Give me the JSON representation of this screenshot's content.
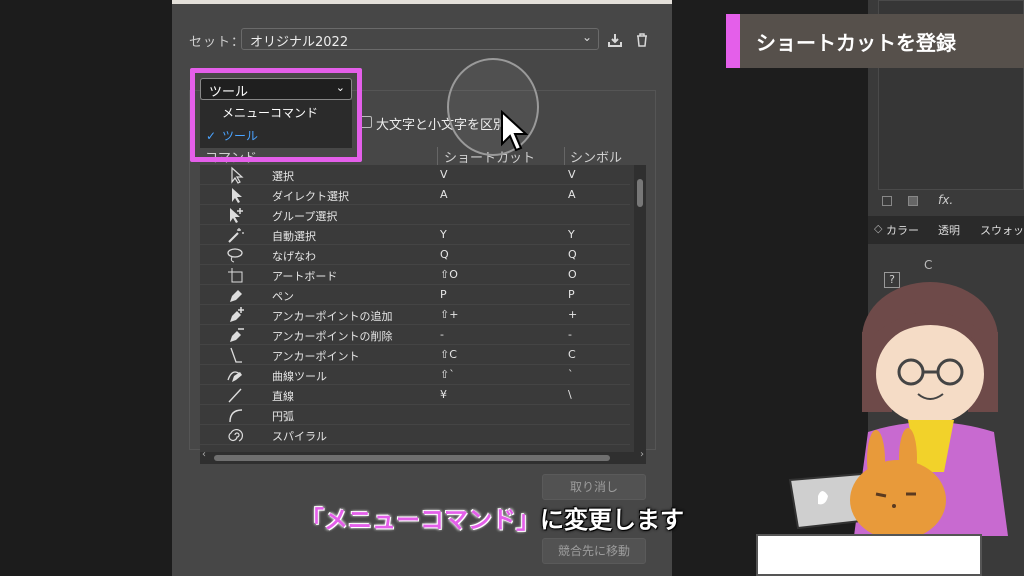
{
  "dialog": {
    "set_label": "セット：",
    "set_value": "オリジナル2022",
    "tool_dropdown_value": "ツール",
    "menu_options": [
      "メニューコマンド",
      "ツール"
    ],
    "case_sensitive_label": "大文字と小文字を区別",
    "columns": [
      "コマンド",
      "ショートカット",
      "シンボル"
    ],
    "rows": [
      {
        "name": "選択",
        "shortcut": "V",
        "symbol": "V",
        "icon": "selection-arrow-icon"
      },
      {
        "name": "ダイレクト選択",
        "shortcut": "A",
        "symbol": "A",
        "icon": "direct-selection-icon"
      },
      {
        "name": "グループ選択",
        "shortcut": "",
        "symbol": "",
        "icon": "group-selection-icon"
      },
      {
        "name": "自動選択",
        "shortcut": "Y",
        "symbol": "Y",
        "icon": "magic-wand-icon"
      },
      {
        "name": "なげなわ",
        "shortcut": "Q",
        "symbol": "Q",
        "icon": "lasso-icon"
      },
      {
        "name": "アートボード",
        "shortcut": "⇧O",
        "symbol": "O",
        "icon": "artboard-icon"
      },
      {
        "name": "ペン",
        "shortcut": "P",
        "symbol": "P",
        "icon": "pen-icon"
      },
      {
        "name": "アンカーポイントの追加",
        "shortcut": "⇧+",
        "symbol": "+",
        "icon": "add-anchor-icon"
      },
      {
        "name": "アンカーポイントの削除",
        "shortcut": "-",
        "symbol": "-",
        "icon": "delete-anchor-icon"
      },
      {
        "name": "アンカーポイント",
        "shortcut": "⇧C",
        "symbol": "C",
        "icon": "anchor-point-icon"
      },
      {
        "name": "曲線ツール",
        "shortcut": "⇧`",
        "symbol": "`",
        "icon": "curvature-icon"
      },
      {
        "name": "直線",
        "shortcut": "¥",
        "symbol": "\\",
        "icon": "line-segment-icon"
      },
      {
        "name": "円弧",
        "shortcut": "",
        "symbol": "",
        "icon": "arc-icon"
      },
      {
        "name": "スパイラル",
        "shortcut": "",
        "symbol": "",
        "icon": "spiral-icon"
      }
    ],
    "buttons": {
      "undo": "取り消し",
      "go_to_conflict": "競合先に移動"
    }
  },
  "title_tag": "ショートカットを登録",
  "subtitle": {
    "quoted": "「メニューコマンド」",
    "rest": "に変更します"
  },
  "right_panel": {
    "tabs": [
      "カラー",
      "透明",
      "スウォッ"
    ],
    "label_c": "C",
    "fx": "fx."
  },
  "colors": {
    "accent": "#e45fea",
    "dialog_bg": "#474747",
    "tag_bg": "#56504b"
  }
}
